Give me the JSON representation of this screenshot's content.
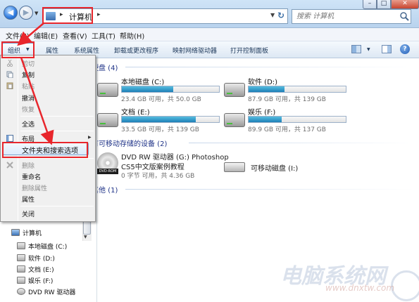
{
  "address": {
    "location_label": "计算机",
    "search_placeholder": "搜索 计算机"
  },
  "window_controls": {
    "minimize": "–",
    "maximize": "□",
    "close": "✕"
  },
  "menubar": [
    {
      "label": "文件(F)"
    },
    {
      "label": "编辑(E)"
    },
    {
      "label": "查看(V)"
    },
    {
      "label": "工具(T)"
    },
    {
      "label": "帮助(H)"
    }
  ],
  "toolbar": {
    "organize": "组织",
    "items": [
      "属性",
      "系统属性",
      "卸载或更改程序",
      "映射网络驱动器",
      "打开控制面板"
    ],
    "help": "?"
  },
  "content": {
    "hard_disks_header": "硬盘 (4)",
    "removable_header": "有可移动存储的设备 (2)",
    "network_header": "其他 (1)",
    "drives": [
      {
        "name": "本地磁盘 (C:)",
        "size": "23.4 GB 可用，共 50.0 GB",
        "used_fraction": 0.53
      },
      {
        "name": "软件 (D:)",
        "size": "87.9 GB 可用，共 139 GB",
        "used_fraction": 0.37
      },
      {
        "name": "文档 (E:)",
        "size": "33.5 GB 可用，共 139 GB",
        "used_fraction": 0.76
      },
      {
        "name": "娱乐 (F:)",
        "size": "89.9 GB 可用，共 137 GB",
        "used_fraction": 0.34
      }
    ],
    "dvd": {
      "line1": "DVD RW 驱动器 (G:) Photoshop",
      "line2": "CS5中文版案例教程",
      "line3": "0 字节 可用，共 4.36 GB",
      "badge": "DVD-ROM"
    },
    "removable": {
      "name": "可移动磁盘 (I:)"
    }
  },
  "navpane": {
    "computer": "计算机",
    "items": [
      "本地磁盘 (C:)",
      "软件 (D:)",
      "文档 (E:)",
      "娱乐 (F:)",
      "DVD RW 驱动器"
    ]
  },
  "context_menu": {
    "items": [
      {
        "label": "剪切",
        "disabled": true
      },
      {
        "label": "复制",
        "disabled": false
      },
      {
        "label": "粘贴",
        "disabled": true
      },
      {
        "label": "撤消",
        "disabled": false
      },
      {
        "label": "恢复",
        "disabled": true
      },
      {
        "label": "全选",
        "disabled": false
      },
      {
        "label": "布局",
        "disabled": false
      },
      {
        "label": "文件夹和搜索选项",
        "disabled": false
      },
      {
        "label": "删除",
        "disabled": true
      },
      {
        "label": "重命名",
        "disabled": false
      },
      {
        "label": "删除属性",
        "disabled": true
      },
      {
        "label": "属性",
        "disabled": false
      },
      {
        "label": "关闭",
        "disabled": false
      }
    ]
  },
  "watermark": {
    "text": "电脑系统网",
    "url": "www.dnxtw.com"
  },
  "colors": {
    "highlight": "#e8262c",
    "accent": "#1d7fb7"
  }
}
